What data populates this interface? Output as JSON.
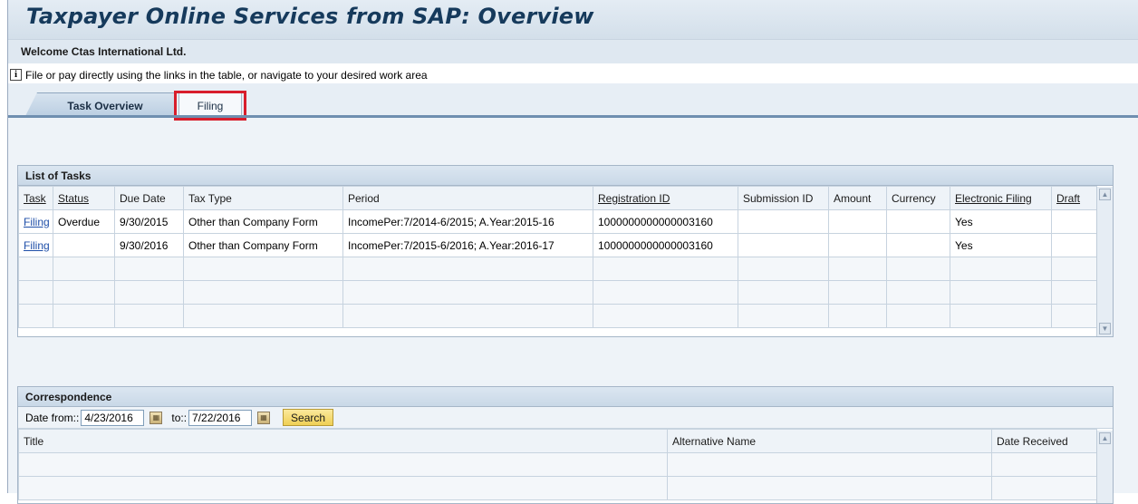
{
  "header": {
    "title": "Taxpayer Online Services from SAP: Overview",
    "welcome": "Welcome Ctas International Ltd."
  },
  "info": {
    "icon": "info-icon",
    "text": "File or pay directly using the links in the table, or navigate to your desired work area"
  },
  "tabs": [
    {
      "label": "Task Overview",
      "active": true
    },
    {
      "label": "Filing",
      "active": false,
      "highlighted": true
    }
  ],
  "tasks": {
    "title": "List of Tasks",
    "columns": [
      "Task",
      "Status",
      "Due Date",
      "Tax Type",
      "Period",
      "Registration ID",
      "Submission ID",
      "Amount",
      "Currency",
      "Electronic Filing",
      "Draft"
    ],
    "rows": [
      {
        "task": "Filing",
        "status": "Overdue",
        "due_date": "9/30/2015",
        "tax_type": "Other than Company Form",
        "period": "IncomePer:7/2014-6/2015; A.Year:2015-16",
        "registration_id": "1000000000000003160",
        "submission_id": "",
        "amount": "",
        "currency": "",
        "electronic_filing": "Yes",
        "draft": ""
      },
      {
        "task": "Filing",
        "status": "",
        "due_date": "9/30/2016",
        "tax_type": "Other than Company Form",
        "period": "IncomePer:7/2015-6/2016; A.Year:2016-17",
        "registration_id": "1000000000000003160",
        "submission_id": "",
        "amount": "",
        "currency": "",
        "electronic_filing": "Yes",
        "draft": ""
      }
    ]
  },
  "correspondence": {
    "title": "Correspondence",
    "date_from_label": "Date from::",
    "date_from": "4/23/2016",
    "date_to_label": "to::",
    "date_to": "7/22/2016",
    "search_label": "Search",
    "columns": [
      "Title",
      "Alternative Name",
      "Date Received"
    ]
  }
}
